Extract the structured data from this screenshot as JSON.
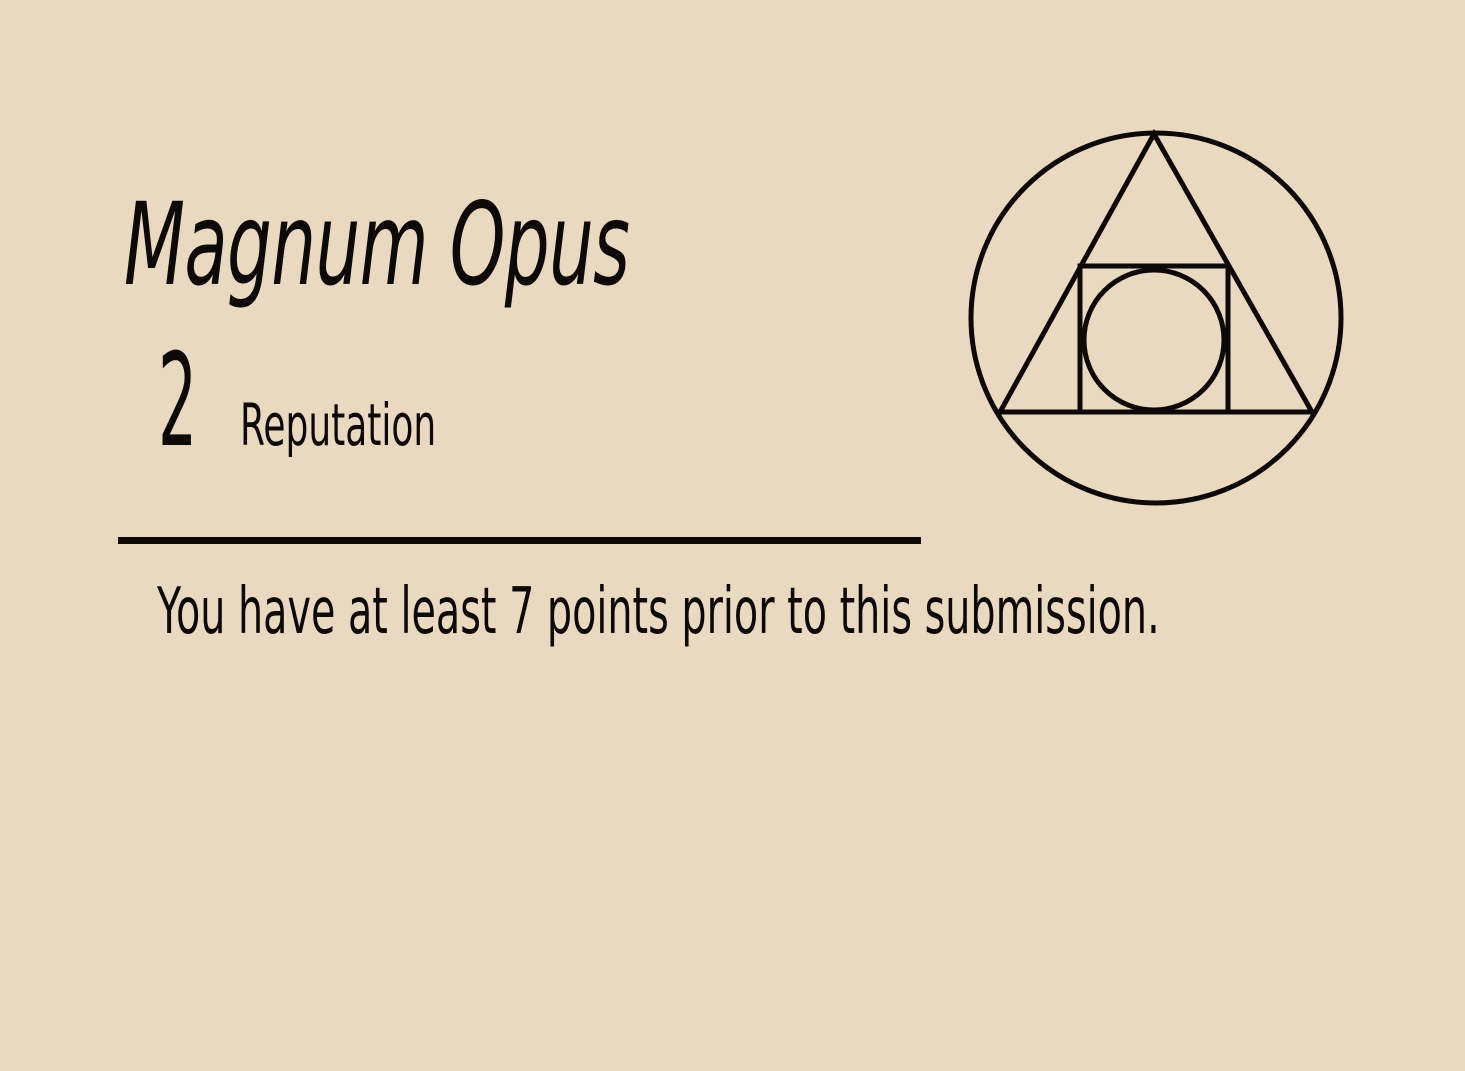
{
  "card": {
    "title": "Magnum Opus",
    "reputation_value": "2",
    "reputation_label": "Reputation",
    "description": "You have at least 7 points prior to this submission.",
    "emblem_icon": "alchemical-squared-circle-icon"
  },
  "colors": {
    "background": "#EAD9C1",
    "ink": "#0D0909"
  }
}
